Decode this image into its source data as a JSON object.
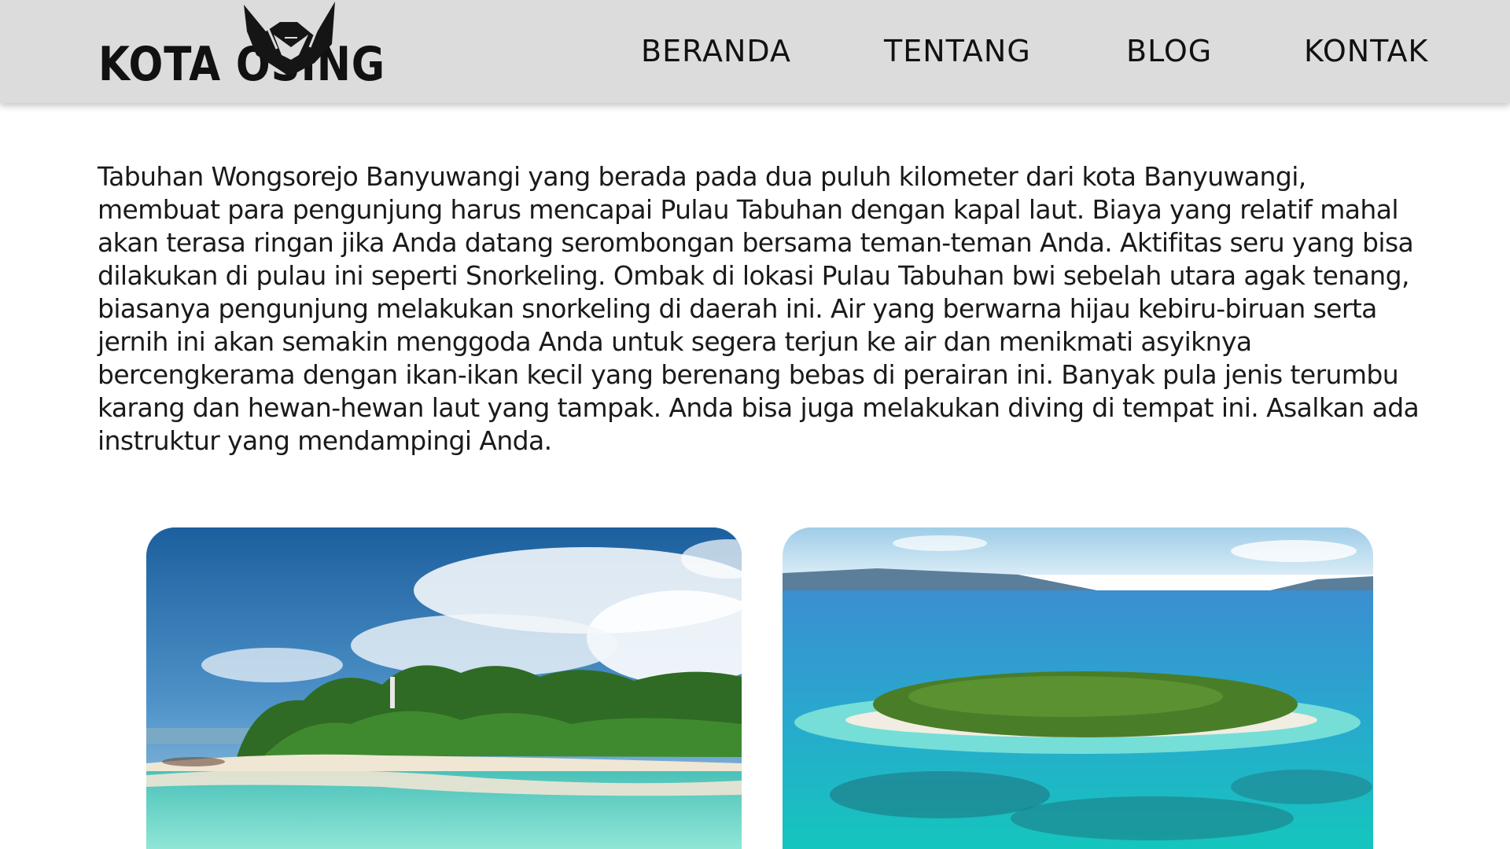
{
  "header": {
    "logo_text": "KOTA OSING",
    "logo_icon": "horned-mask-icon",
    "background": "#dcdcdc",
    "nav": {
      "beranda": "BERANDA",
      "tentang": "TENTANG",
      "blog": "BLOG",
      "kontak": "KONTAK"
    }
  },
  "article": {
    "body": "Tabuhan Wongsorejo Banyuwangi yang berada pada dua puluh kilometer dari kota Banyuwangi, membuat para pengunjung harus mencapai Pulau Tabuhan dengan kapal laut. Biaya yang relatif mahal akan terasa ringan jika Anda datang serombongan bersama teman-teman Anda. Aktifitas seru yang bisa dilakukan di pulau ini seperti Snorkeling. Ombak di lokasi Pulau Tabuhan bwi sebelah utara agak tenang, biasanya pengunjung melakukan snorkeling di daerah ini. Air yang berwarna hijau kebiru-biruan serta jernih ini akan semakin menggoda Anda untuk segera terjun ke air dan menikmati asyiknya bercengkerama dengan ikan-ikan kecil yang berenang bebas di perairan ini. Banyak pula jenis terumbu karang dan hewan-hewan laut yang tampak. Anda bisa juga melakukan diving di tempat ini. Asalkan ada instruktur yang mendampingi Anda."
  },
  "gallery": {
    "images": [
      {
        "name": "beach-shore-photo",
        "colors": {
          "sky": "#2e78b8",
          "water": "#5fd3c4",
          "trees": "#2f6b25",
          "sand": "#efe6d4"
        }
      },
      {
        "name": "island-aerial-photo",
        "colors": {
          "sky": "#cfe6f5",
          "water": "#1fb8c9",
          "trees": "#4a7d28",
          "sand": "#f1ede2"
        }
      }
    ]
  }
}
